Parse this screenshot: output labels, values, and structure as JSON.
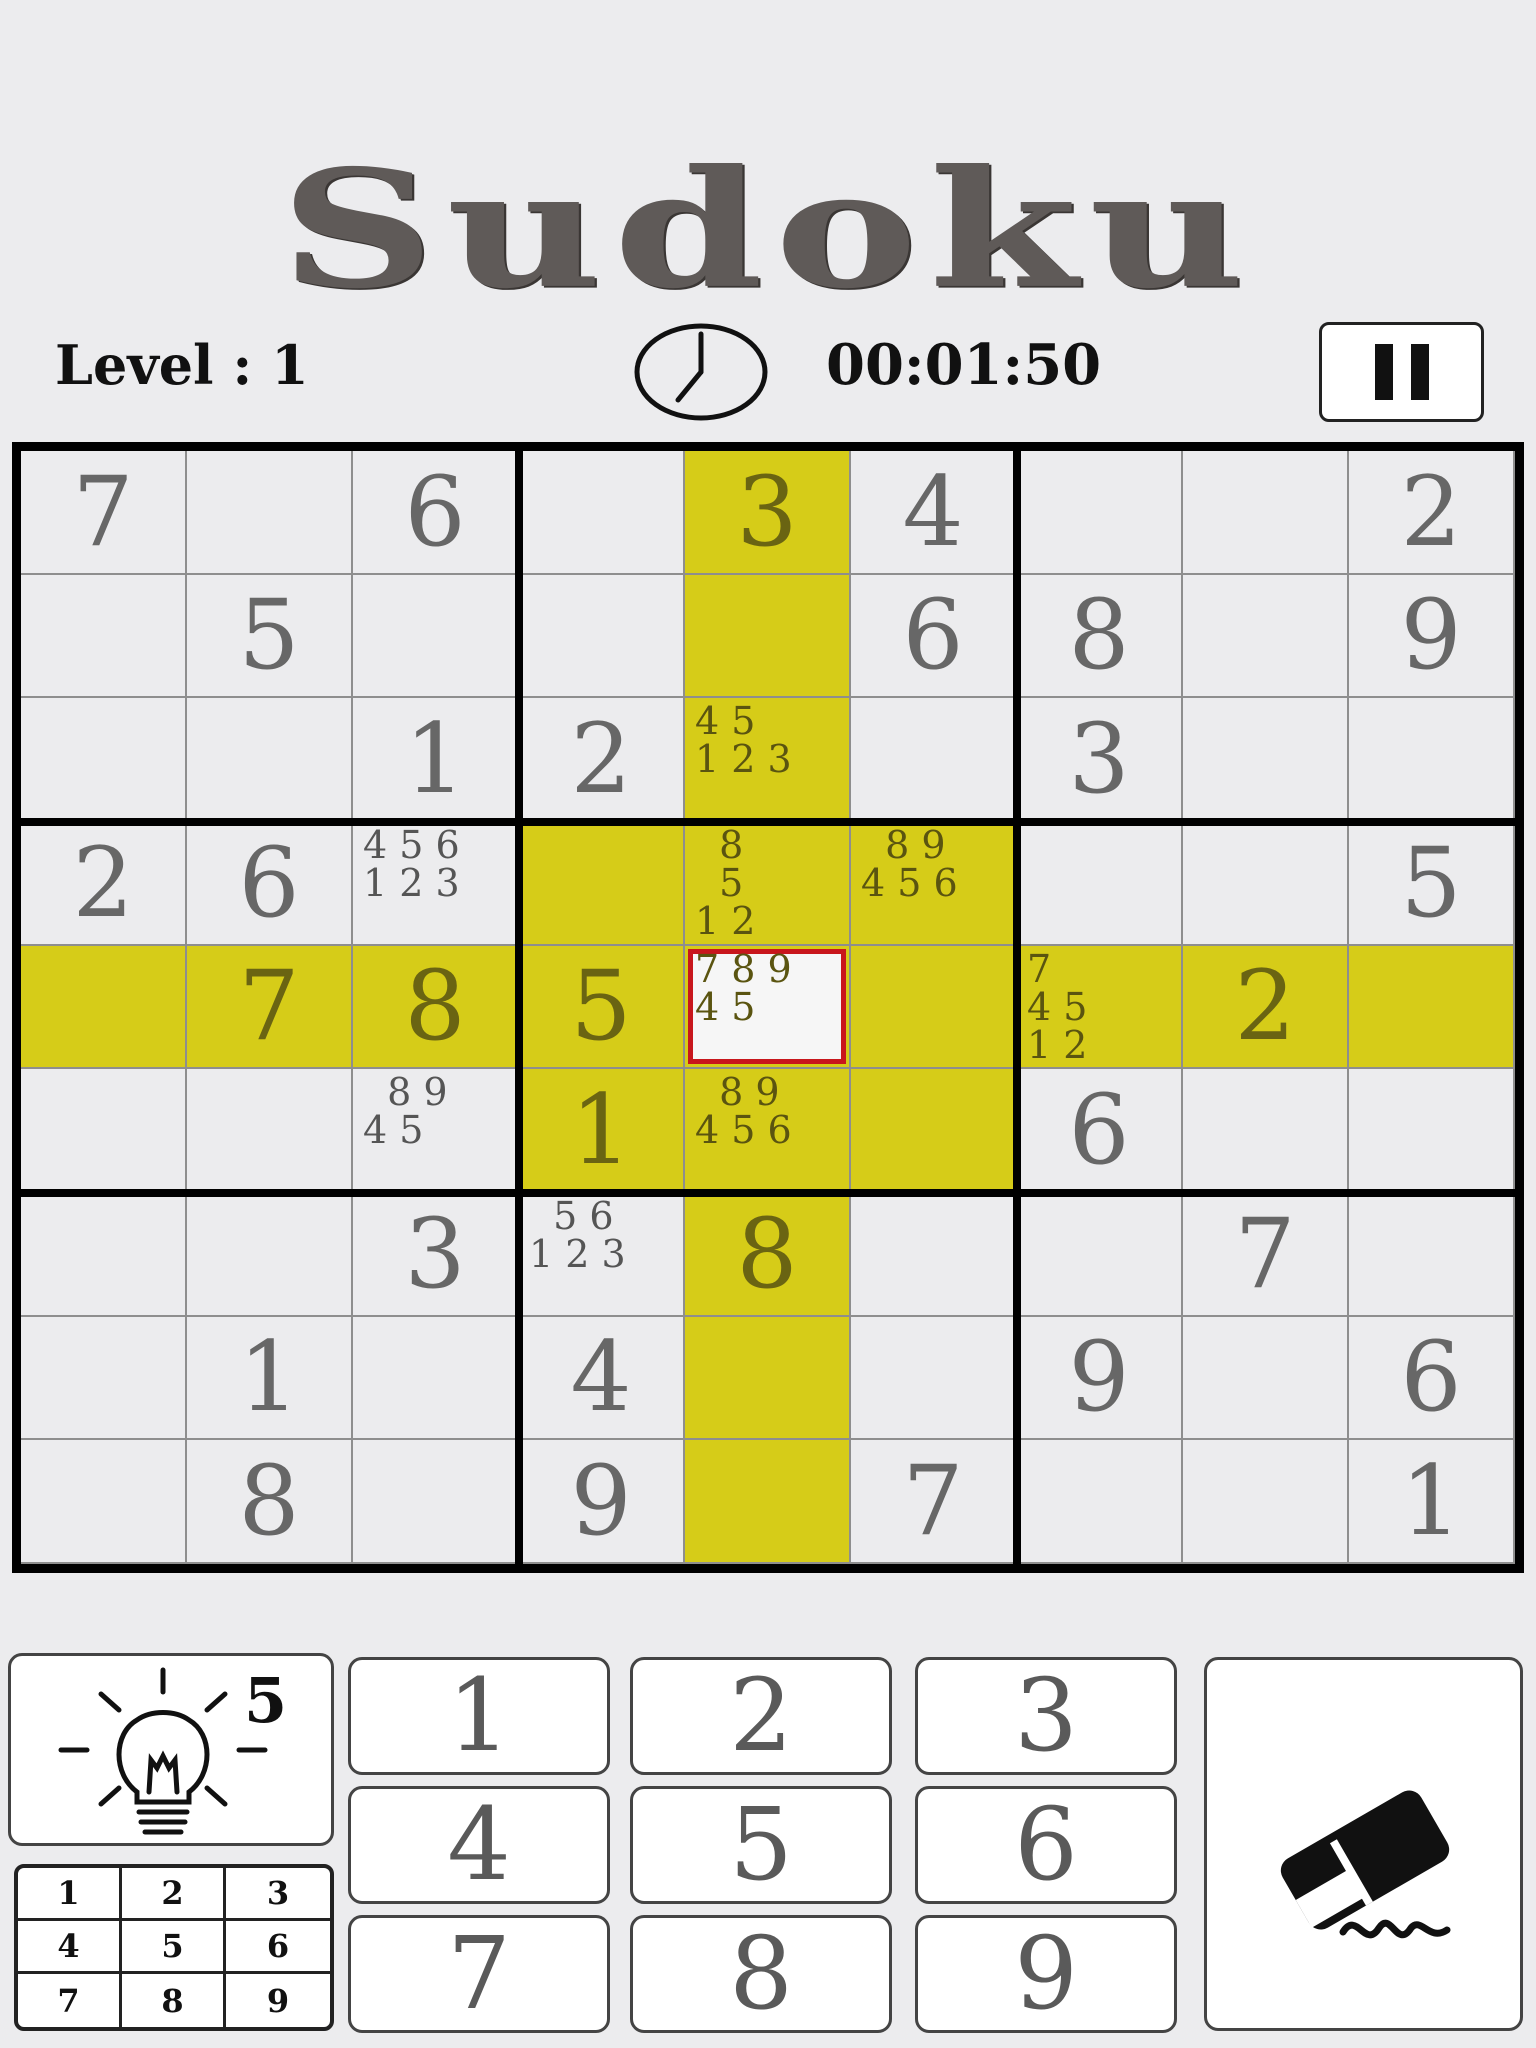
{
  "title": "Sudoku",
  "status": {
    "level_text": "Level : 1",
    "timer": "00:01:50"
  },
  "colors": {
    "highlight": "#d6cc18",
    "selected_border": "#c8161c",
    "given_digit": "#676767"
  },
  "icons": {
    "clock": "clock-icon",
    "pause": "pause-icon",
    "hint": "lightbulb-icon",
    "erase": "eraser-icon"
  },
  "board": {
    "selected": [
      4,
      4
    ],
    "highlighted_row": 4,
    "highlighted_col": 4,
    "highlighted_box": [
      1,
      1
    ],
    "cells": [
      [
        "7",
        "",
        "6",
        "",
        "3",
        "4",
        "",
        "",
        "2"
      ],
      [
        "",
        "5",
        "",
        "",
        "",
        "6",
        "8",
        "",
        "9"
      ],
      [
        "",
        "",
        "1",
        "2",
        "",
        "",
        "3",
        "",
        ""
      ],
      [
        "2",
        "6",
        "",
        "",
        "",
        "",
        "",
        "",
        "5"
      ],
      [
        "",
        "7",
        "8",
        "5",
        "",
        "",
        "",
        "2",
        ""
      ],
      [
        "",
        "",
        "",
        "1",
        "",
        "",
        "6",
        "",
        ""
      ],
      [
        "",
        "",
        "3",
        "",
        "8",
        "",
        "",
        "7",
        ""
      ],
      [
        "",
        "1",
        "",
        "4",
        "",
        "",
        "9",
        "",
        "6"
      ],
      [
        "",
        "8",
        "",
        "9",
        "",
        "7",
        "",
        "",
        "1"
      ]
    ],
    "notes": [
      {
        "row": 2,
        "col": 4,
        "text": "4 5\n1 2 3"
      },
      {
        "row": 3,
        "col": 2,
        "text": "4 5 6\n1 2 3"
      },
      {
        "row": 3,
        "col": 4,
        "text": "  8\n  5\n1 2"
      },
      {
        "row": 3,
        "col": 5,
        "text": "  8 9\n4 5 6"
      },
      {
        "row": 4,
        "col": 4,
        "text": "7 8 9\n4 5"
      },
      {
        "row": 4,
        "col": 6,
        "text": "7\n4 5\n1 2"
      },
      {
        "row": 5,
        "col": 2,
        "text": "  8 9\n4 5"
      },
      {
        "row": 5,
        "col": 4,
        "text": "  8 9\n4 5 6"
      },
      {
        "row": 6,
        "col": 3,
        "text": "  5 6\n1 2 3"
      }
    ]
  },
  "controls": {
    "hint_count": "5",
    "numbers": [
      "1",
      "2",
      "3",
      "4",
      "5",
      "6",
      "7",
      "8",
      "9"
    ],
    "note_grid": [
      "1",
      "2",
      "3",
      "4",
      "5",
      "6",
      "7",
      "8",
      "9"
    ]
  }
}
